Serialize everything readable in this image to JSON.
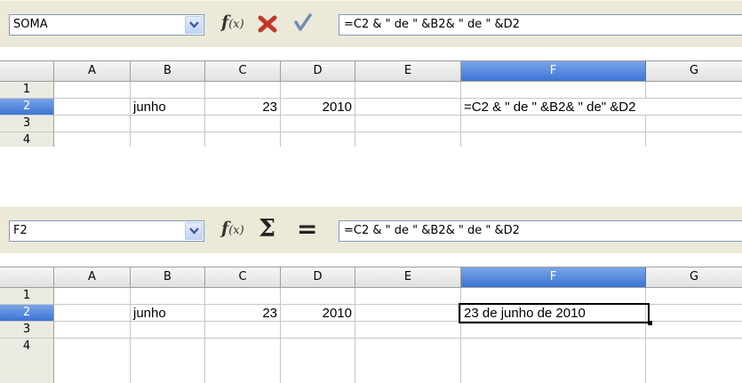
{
  "top": {
    "name_box": "SOMA",
    "formula": "=C2 & \" de \" &B2& \" de \" &D2",
    "columns": [
      "A",
      "B",
      "C",
      "D",
      "E",
      "F",
      "G"
    ],
    "rows": [
      "1",
      "2",
      "3",
      "4"
    ],
    "cells": {
      "B2": "junho",
      "C2": "23",
      "D2": "2010",
      "F2": "=C2 & \" de \" &B2& \" de\" &D2"
    }
  },
  "bottom": {
    "name_box": "F2",
    "formula": "=C2 & \" de \" &B2& \" de \" &D2",
    "columns": [
      "A",
      "B",
      "C",
      "D",
      "E",
      "F",
      "G"
    ],
    "rows": [
      "1",
      "2",
      "3",
      "4"
    ],
    "cells": {
      "B2": "junho",
      "C2": "23",
      "D2": "2010",
      "F2": "23 de junho de 2010"
    }
  },
  "icons": {
    "function_wizard": "fx-icon",
    "cancel": "cancel-x-icon",
    "accept": "accept-check-icon",
    "sum": "sum-sigma-icon",
    "function": "equals-function-icon"
  },
  "colors": {
    "selected_header": "#3c74d4",
    "toolbar": "#ece9d8",
    "cancel": "#c0392b",
    "accept": "#6b8fb5"
  }
}
